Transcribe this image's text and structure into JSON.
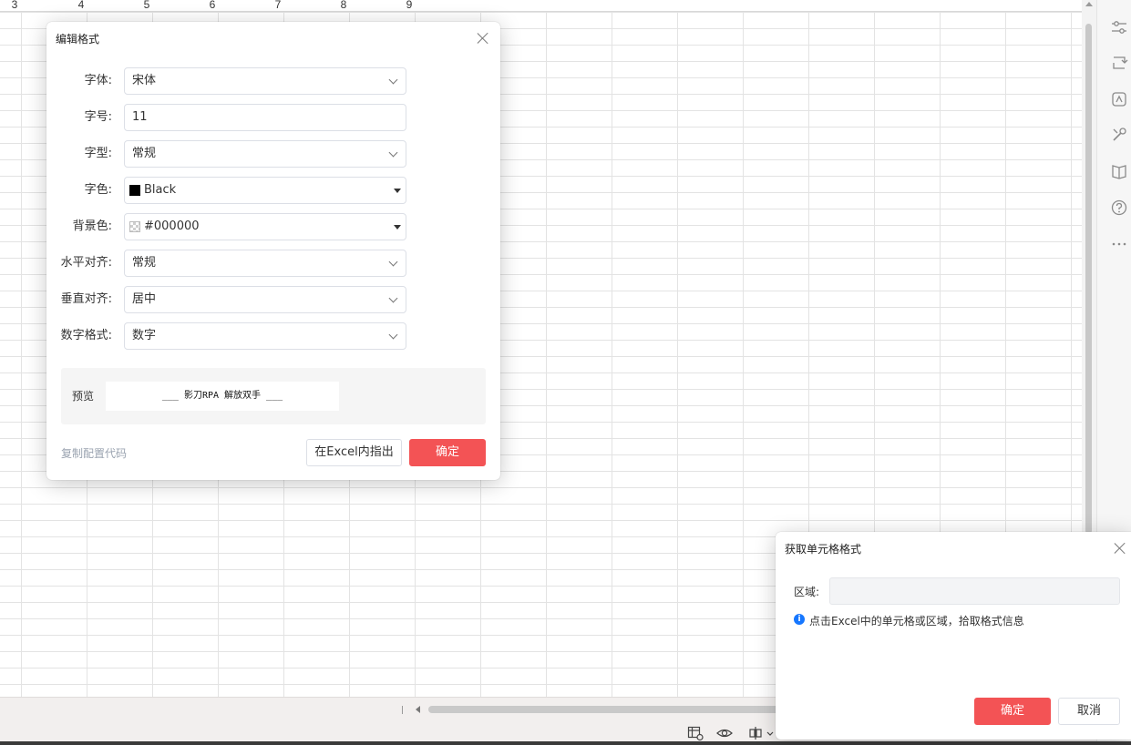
{
  "sheet": {
    "column_numbers": [
      "3",
      "4",
      "5",
      "6",
      "7",
      "8",
      "9"
    ]
  },
  "edit_dialog": {
    "title": "编辑格式",
    "fields": {
      "font": {
        "label": "字体:",
        "value": "宋体"
      },
      "size": {
        "label": "字号:",
        "value": "11"
      },
      "style": {
        "label": "字型:",
        "value": "常规"
      },
      "color": {
        "label": "字色:",
        "value": "Black",
        "swatch": "#000000"
      },
      "background": {
        "label": "背景色:",
        "value": "#000000"
      },
      "h_align": {
        "label": "水平对齐:",
        "value": "常规"
      },
      "v_align": {
        "label": "垂直对齐:",
        "value": "居中"
      },
      "number_format": {
        "label": "数字格式:",
        "value": "数字"
      }
    },
    "preview": {
      "label": "预览",
      "sample": "___ 影刀RPA 解放双手 ___"
    },
    "copy_config_link": "复制配置代码",
    "locate_button": "在Excel内指出",
    "confirm_button": "确定"
  },
  "cell_format_dialog": {
    "title": "获取单元格格式",
    "range_label": "区域:",
    "range_value": "",
    "hint": "点击Excel中的单元格或区域，拾取格式信息",
    "confirm_button": "确定",
    "cancel_button": "取消"
  },
  "colors": {
    "primary": "#f35355",
    "info": "#1677ff",
    "link": "#9aa3b0"
  },
  "icons": {
    "rail": [
      "sliders-icon",
      "swap-icon",
      "ai-icon",
      "tools-icon",
      "book-icon",
      "help-icon",
      "more-icon"
    ],
    "status": [
      "table-view-icon",
      "eye-icon",
      "layout-icon"
    ]
  }
}
